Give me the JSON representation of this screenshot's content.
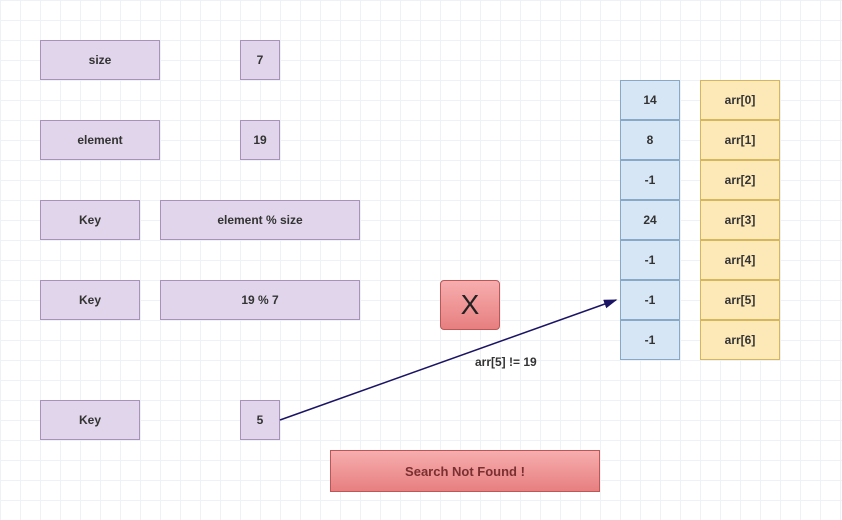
{
  "rows": {
    "size": {
      "label": "size",
      "value": "7"
    },
    "element": {
      "label": "element",
      "value": "19"
    },
    "key1": {
      "label": "Key",
      "value": "element % size"
    },
    "key2": {
      "label": "Key",
      "value": "19 % 7"
    },
    "key3": {
      "label": "Key",
      "value": "5"
    }
  },
  "array_values": [
    "14",
    "8",
    "-1",
    "24",
    "-1",
    "-1",
    "-1"
  ],
  "array_labels": [
    "arr[0]",
    "arr[1]",
    "arr[2]",
    "arr[3]",
    "arr[4]",
    "arr[5]",
    "arr[6]"
  ],
  "x_mark": "X",
  "annotation": "arr[5] != 19",
  "result": "Search Not Found !"
}
